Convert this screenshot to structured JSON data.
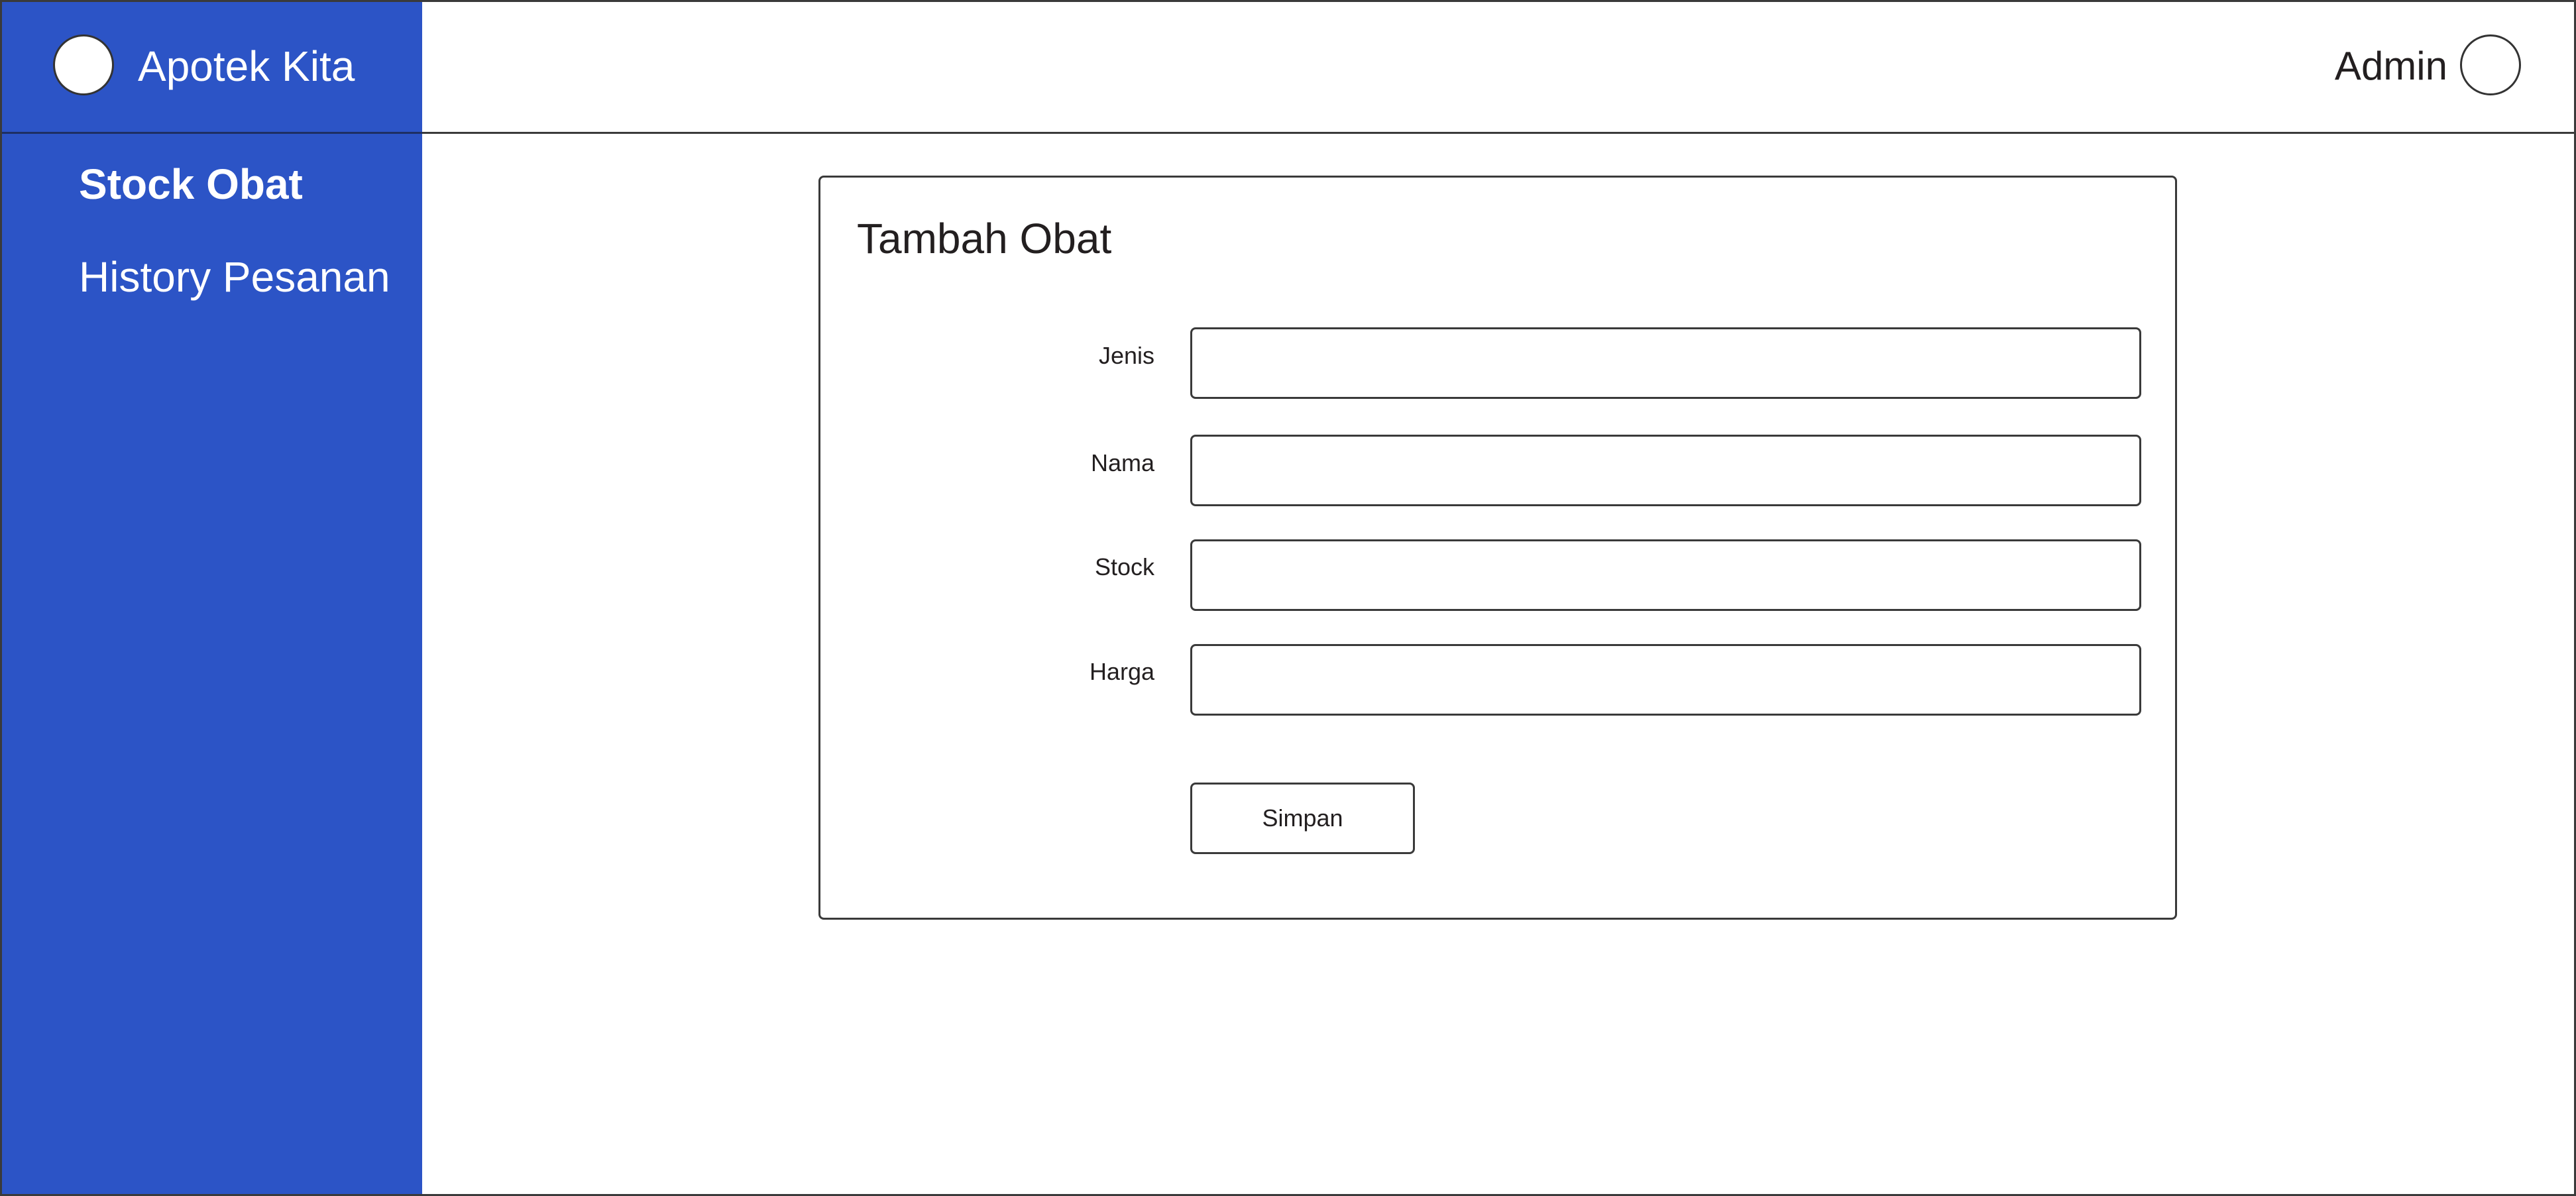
{
  "app": {
    "name": "Apotek Kita"
  },
  "sidebar": {
    "items": [
      {
        "label": "Stock Obat",
        "active": true
      },
      {
        "label": "History Pesanan",
        "active": false
      }
    ]
  },
  "header": {
    "user_name": "Admin"
  },
  "form": {
    "title": "Tambah Obat",
    "fields": [
      {
        "label": "Jenis",
        "value": ""
      },
      {
        "label": "Nama",
        "value": ""
      },
      {
        "label": "Stock",
        "value": ""
      },
      {
        "label": "Harga",
        "value": ""
      }
    ],
    "submit_label": "Simpan"
  },
  "colors": {
    "sidebar_bg": "#2c54c6",
    "text": "#231f20",
    "border": "#3a3a3a",
    "background": "#ffffff"
  }
}
